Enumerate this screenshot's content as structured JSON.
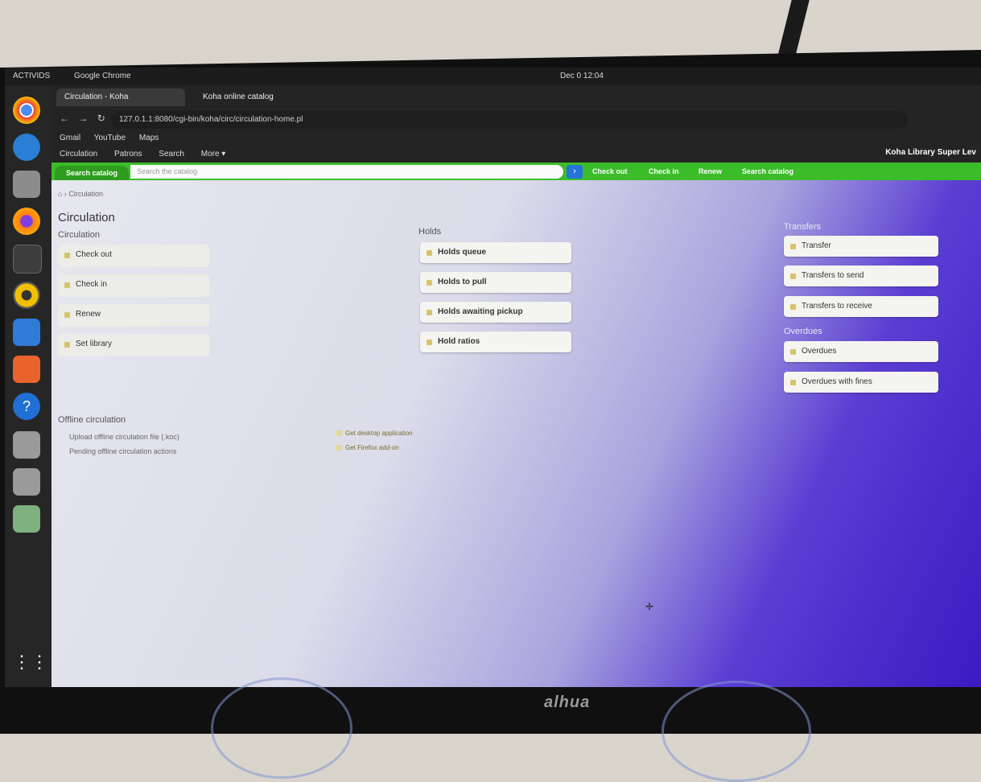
{
  "topbar": {
    "activities": "ACTIVIDS",
    "app": "Google Chrome",
    "clock": "Dec 0 12:04"
  },
  "tabs": [
    {
      "label": "Circulation - Koha"
    },
    {
      "label": "Koha online catalog"
    }
  ],
  "address": "127.0.1.1:8080/cgi-bin/koha/circ/circulation-home.pl",
  "bookmarks": [
    "Gmail",
    "YouTube",
    "Maps"
  ],
  "koha_nav": [
    "Circulation",
    "Patrons",
    "Search",
    "More ▾"
  ],
  "user_label": "Koha Library  Super Lev",
  "search": {
    "tab": "Search catalog",
    "placeholder": "Search the catalog",
    "go": "›"
  },
  "quick_links": [
    "Check out",
    "Check in",
    "Renew",
    "Search catalog"
  ],
  "breadcrumb": "⌂ › Circulation",
  "page_title": "Circulation",
  "circulation": {
    "heading": "Circulation",
    "items": [
      "Check out",
      "Check in",
      "Renew",
      "Set library"
    ]
  },
  "holds": {
    "heading": "Holds",
    "items": [
      "Holds queue",
      "Holds to pull",
      "Holds awaiting pickup",
      "Hold ratios"
    ]
  },
  "transfers": {
    "heading": "Transfers",
    "items": [
      "Transfer",
      "Transfers to send",
      "Transfers to receive"
    ]
  },
  "overdues": {
    "heading": "Overdues",
    "items": [
      "Overdues",
      "Overdues with fines"
    ]
  },
  "offline": {
    "heading": "Offline circulation",
    "links": [
      "Upload offline circulation file (.koc)",
      "Pending offline circulation actions"
    ],
    "apps": [
      "Get desktop application",
      "Get Firefox add-on"
    ]
  },
  "bezel_brand": "alhua",
  "colors": {
    "koha_green": "#3bbd2a",
    "accent_blue": "#2673d9",
    "wallpaper_purple": "#3a1bc2"
  },
  "icons": [
    "chrome-icon",
    "thunderbird-icon",
    "files-icon",
    "firefox-icon",
    "terminal-icon",
    "rhythmbox-icon",
    "writer-icon",
    "software-icon",
    "help-icon",
    "app-grid-icon"
  ]
}
